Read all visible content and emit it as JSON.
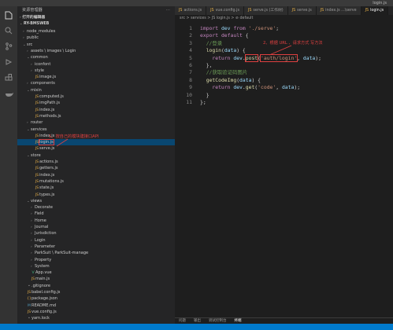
{
  "window": {
    "title": "login.js"
  },
  "activity_bar": {
    "icons": [
      "files-icon",
      "search-icon",
      "source-control-icon",
      "debug-icon",
      "extensions-icon",
      "docker-icon"
    ]
  },
  "sidebar": {
    "header": "资源管理器",
    "open_editors": "打开的编辑器",
    "project": "RY-BMSWEB",
    "tree": [
      {
        "label": "node_modules",
        "depth": 1,
        "type": "folder",
        "open": false
      },
      {
        "label": "public",
        "depth": 1,
        "type": "folder",
        "open": false
      },
      {
        "label": "src",
        "depth": 1,
        "type": "folder",
        "open": true
      },
      {
        "label": "assets \\ images \\ Login",
        "depth": 2,
        "type": "folder",
        "open": false
      },
      {
        "label": "common",
        "depth": 2,
        "type": "folder",
        "open": true
      },
      {
        "label": "iconfont",
        "depth": 3,
        "type": "folder",
        "open": false
      },
      {
        "label": "style",
        "depth": 3,
        "type": "folder",
        "open": false
      },
      {
        "label": "image.js",
        "depth": 3,
        "type": "js"
      },
      {
        "label": "components",
        "depth": 2,
        "type": "folder",
        "open": false
      },
      {
        "label": "mixin",
        "depth": 2,
        "type": "folder",
        "open": true
      },
      {
        "label": "computed.js",
        "depth": 3,
        "type": "js"
      },
      {
        "label": "imgPath.js",
        "depth": 3,
        "type": "js"
      },
      {
        "label": "index.js",
        "depth": 3,
        "type": "js"
      },
      {
        "label": "methods.js",
        "depth": 3,
        "type": "js"
      },
      {
        "label": "router",
        "depth": 2,
        "type": "folder",
        "open": false
      },
      {
        "label": "services",
        "depth": 2,
        "type": "folder",
        "open": true
      },
      {
        "label": "index.js",
        "depth": 3,
        "type": "js"
      },
      {
        "label": "login.js",
        "depth": 3,
        "type": "js",
        "selected": true
      },
      {
        "label": "serve.js",
        "depth": 3,
        "type": "js"
      },
      {
        "label": "store",
        "depth": 2,
        "type": "folder",
        "open": true
      },
      {
        "label": "actions.js",
        "depth": 3,
        "type": "js"
      },
      {
        "label": "getters.js",
        "depth": 3,
        "type": "js"
      },
      {
        "label": "index.js",
        "depth": 3,
        "type": "js"
      },
      {
        "label": "mutations.js",
        "depth": 3,
        "type": "js"
      },
      {
        "label": "state.js",
        "depth": 3,
        "type": "js"
      },
      {
        "label": "types.js",
        "depth": 3,
        "type": "js"
      },
      {
        "label": "views",
        "depth": 2,
        "type": "folder",
        "open": true
      },
      {
        "label": "Decorate",
        "depth": 3,
        "type": "folder",
        "open": false
      },
      {
        "label": "Field",
        "depth": 3,
        "type": "folder",
        "open": false
      },
      {
        "label": "Home",
        "depth": 3,
        "type": "folder",
        "open": false
      },
      {
        "label": "Journal",
        "depth": 3,
        "type": "folder",
        "open": false
      },
      {
        "label": "Jurisdiction",
        "depth": 3,
        "type": "folder",
        "open": false
      },
      {
        "label": "Login",
        "depth": 3,
        "type": "folder",
        "open": false
      },
      {
        "label": "Parameter",
        "depth": 3,
        "type": "folder",
        "open": false
      },
      {
        "label": "ParkSuit \\ ParkSuit-manage",
        "depth": 3,
        "type": "folder",
        "open": false
      },
      {
        "label": "Property",
        "depth": 3,
        "type": "folder",
        "open": false
      },
      {
        "label": "System",
        "depth": 3,
        "type": "folder",
        "open": false
      },
      {
        "label": "App.vue",
        "depth": 2,
        "type": "vue"
      },
      {
        "label": "main.js",
        "depth": 2,
        "type": "js"
      },
      {
        "label": ".gitignore",
        "depth": 1,
        "type": "file"
      },
      {
        "label": "babel.config.js",
        "depth": 1,
        "type": "js"
      },
      {
        "label": "package.json",
        "depth": 1,
        "type": "json"
      },
      {
        "label": "README.md",
        "depth": 1,
        "type": "md"
      },
      {
        "label": "vue.config.js",
        "depth": 1,
        "type": "js"
      },
      {
        "label": "yarn.lock",
        "depth": 1,
        "type": "file"
      }
    ]
  },
  "tabs": [
    {
      "label": "actions.js",
      "active": false
    },
    {
      "label": "vue.config.js",
      "active": false
    },
    {
      "label": "serve.js (工作树)",
      "active": false
    },
    {
      "label": "serve.js",
      "active": false
    },
    {
      "label": "index.js ...\\serve",
      "active": false
    },
    {
      "label": "login.js",
      "active": true
    }
  ],
  "breadcrumb": "src > services > JS login.js > ⊘ default",
  "code": {
    "line_numbers": [
      "1",
      "2",
      "3",
      "4",
      "5",
      "6",
      "7",
      "8",
      "9",
      "10",
      "11"
    ]
  },
  "annotations": {
    "left": "1、按自己的模块建接口API",
    "right": "2、根据 URL 、请求方式  写方法"
  },
  "panel": {
    "tabs": [
      "问题",
      "输出",
      "调试控制台",
      "终端"
    ],
    "active": "终端"
  },
  "colors": {
    "accent": "#007acc",
    "annotation": "#e04040",
    "selected": "#094771"
  }
}
